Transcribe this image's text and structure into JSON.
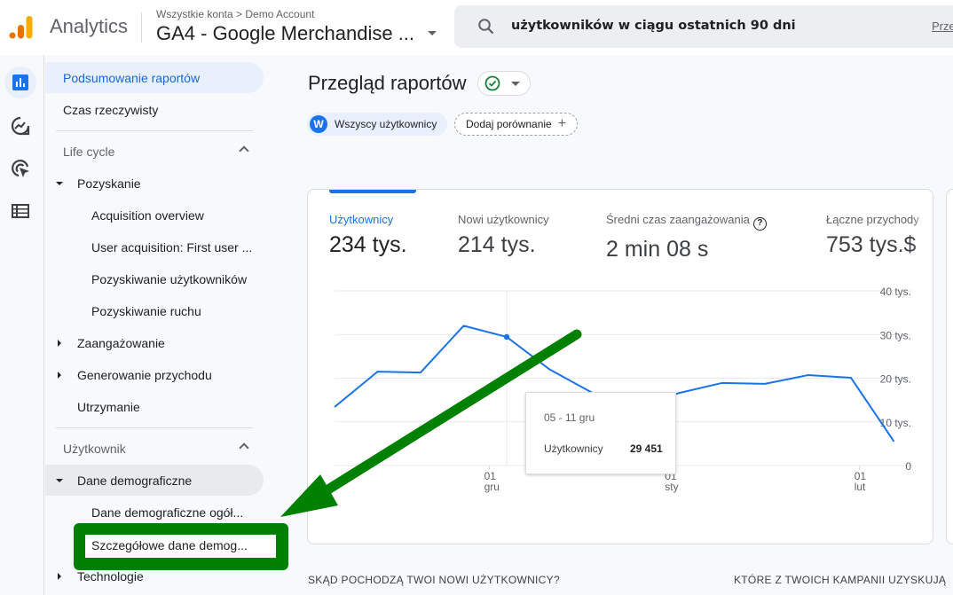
{
  "header": {
    "brand": "Analytics",
    "breadcrumb": "Wszystkie konta > Demo Account",
    "account": "GA4 - Google Merchandise ...",
    "search": {
      "value": "użytkowników w ciągu ostatnich 90 dni",
      "link": "Prze"
    }
  },
  "rail": {
    "items": [
      {
        "icon": "reports-bar-chart-icon",
        "active": true
      },
      {
        "icon": "explore-icon",
        "active": false
      },
      {
        "icon": "advertising-icon",
        "active": false
      },
      {
        "icon": "configure-list-icon",
        "active": false
      }
    ]
  },
  "nav": {
    "summary": "Podsumowanie raportów",
    "realtime": "Czas rzeczywisty",
    "lifecycle": "Life cycle",
    "acquisition": "Pozyskanie",
    "acq_items": [
      "Acquisition overview",
      "User acquisition: First user ...",
      "Pozyskiwanie użytkowników",
      "Pozyskiwanie ruchu"
    ],
    "engagement": "Zaangażowanie",
    "monetization": "Generowanie przychodu",
    "retention": "Utrzymanie",
    "user": "Użytkownik",
    "demographics": "Dane demograficzne",
    "demo_items": [
      "Dane demograficzne ogół...",
      "Szczegółowe dane demog..."
    ],
    "tech": "Technologie"
  },
  "main": {
    "title": "Przegląd raportów",
    "chip_users_avatar": "W",
    "chip_users": "Wszyscy użytkownicy",
    "chip_add": "Dodaj porównanie",
    "metrics": [
      {
        "label": "Użytkownicy",
        "value": "234 tys."
      },
      {
        "label": "Nowi użytkownicy",
        "value": "214 tys."
      },
      {
        "label": "Średni czas zaangażowania",
        "value": "2 min 08 s"
      },
      {
        "label": "Łączne przychody",
        "value": "753 tys.$"
      }
    ],
    "tooltip": {
      "date": "05 - 11 gru",
      "label": "Użytkownicy",
      "value": "29 451"
    },
    "section1": "SKĄD POCHODZĄ TWOI NOWI UŻYTKOWNICY?",
    "section2": "KTÓRE Z TWOICH KAMPANII UZYSKUJĄ"
  },
  "chart_data": {
    "type": "line",
    "title": "",
    "series": [
      {
        "name": "Użytkownicy",
        "color": "#1a73e8",
        "values": [
          13400,
          21500,
          21300,
          32000,
          29451,
          22000,
          16600,
          13200,
          16600,
          18900,
          18700,
          20700,
          20100,
          5500
        ]
      }
    ],
    "x_tick_labels": [
      {
        "index": 3.6,
        "label": [
          "01",
          "gru"
        ]
      },
      {
        "index": 7.8,
        "label": [
          "01",
          "sty"
        ]
      },
      {
        "index": 12.2,
        "label": [
          "01",
          "lut"
        ]
      }
    ],
    "y_ticks": [
      0,
      10000,
      20000,
      30000,
      40000
    ],
    "y_tick_labels": [
      "0",
      "10 tys.",
      "20 tys.",
      "30 tys.",
      "40 tys."
    ],
    "ylim": [
      0,
      40000
    ],
    "highlight_index": 4,
    "grid": true,
    "ylabel": "",
    "xlabel": ""
  },
  "annotation": {
    "color": "#008000"
  }
}
